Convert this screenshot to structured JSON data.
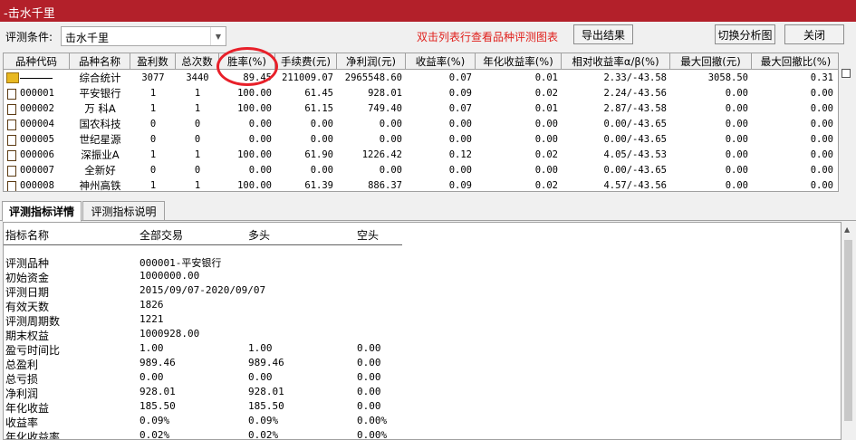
{
  "window": {
    "title": "-击水千里"
  },
  "toolbar": {
    "condition_label": "评测条件:",
    "condition_value": "击水千里",
    "hint": "双击列表行查看品种评测图表",
    "export_label": "导出结果",
    "switch_label": "切换分析图",
    "close_label": "关闭"
  },
  "grid": {
    "columns": [
      "品种代码",
      "品种名称",
      "盈利数",
      "总次数",
      "胜率(%)",
      "手续费(元)",
      "净利润(元)",
      "收益率(%)",
      "年化收益率(%)",
      "相对收益率α/β(%)",
      "最大回撤(元)",
      "最大回撤比(%)"
    ],
    "summary": [
      "",
      "综合统计",
      "3077",
      "3440",
      "89.45",
      "211009.07",
      "2965548.60",
      "0.07",
      "0.01",
      "2.33/-43.58",
      "3058.50",
      "0.31"
    ],
    "rows": [
      [
        "000001",
        "平安银行",
        "1",
        "1",
        "100.00",
        "61.45",
        "928.01",
        "0.09",
        "0.02",
        "2.24/-43.56",
        "0.00",
        "0.00"
      ],
      [
        "000002",
        "万 科A",
        "1",
        "1",
        "100.00",
        "61.15",
        "749.40",
        "0.07",
        "0.01",
        "2.87/-43.58",
        "0.00",
        "0.00"
      ],
      [
        "000004",
        "国农科技",
        "0",
        "0",
        "0.00",
        "0.00",
        "0.00",
        "0.00",
        "0.00",
        "0.00/-43.65",
        "0.00",
        "0.00"
      ],
      [
        "000005",
        "世纪星源",
        "0",
        "0",
        "0.00",
        "0.00",
        "0.00",
        "0.00",
        "0.00",
        "0.00/-43.65",
        "0.00",
        "0.00"
      ],
      [
        "000006",
        "深振业A",
        "1",
        "1",
        "100.00",
        "61.90",
        "1226.42",
        "0.12",
        "0.02",
        "4.05/-43.53",
        "0.00",
        "0.00"
      ],
      [
        "000007",
        "全新好",
        "0",
        "0",
        "0.00",
        "0.00",
        "0.00",
        "0.00",
        "0.00",
        "0.00/-43.65",
        "0.00",
        "0.00"
      ],
      [
        "000008",
        "神州高铁",
        "1",
        "1",
        "100.00",
        "61.39",
        "886.37",
        "0.09",
        "0.02",
        "4.57/-43.56",
        "0.00",
        "0.00"
      ]
    ]
  },
  "tabs": {
    "details": "评测指标详情",
    "explain": "评测指标说明"
  },
  "detail": {
    "headers": [
      "指标名称",
      "全部交易",
      "多头",
      "空头"
    ],
    "rows": [
      [
        "评测品种",
        "000001-平安银行",
        "",
        ""
      ],
      [
        "初始资金",
        "1000000.00",
        "",
        ""
      ],
      [
        "评测日期",
        "2015/09/07-2020/09/07",
        "",
        ""
      ],
      [
        "有效天数",
        "1826",
        "",
        ""
      ],
      [
        "评测周期数",
        "1221",
        "",
        ""
      ],
      [
        "期末权益",
        "1000928.00",
        "",
        ""
      ],
      [
        "盈亏时间比",
        "1.00",
        "1.00",
        "0.00"
      ],
      [
        "总盈利",
        "989.46",
        "989.46",
        "0.00"
      ],
      [
        "总亏损",
        "0.00",
        "0.00",
        "0.00"
      ],
      [
        "净利润",
        "928.01",
        "928.01",
        "0.00"
      ],
      [
        "年化收益",
        "185.50",
        "185.50",
        "0.00"
      ],
      [
        "收益率",
        "0.09%",
        "0.09%",
        "0.00%"
      ],
      [
        "年化收益率",
        "0.02%",
        "0.02%",
        "0.00%"
      ]
    ]
  },
  "colors": {
    "titlebar": "#b3202a",
    "hint": "#e0201c",
    "annotation_circle": "#e8202a"
  }
}
